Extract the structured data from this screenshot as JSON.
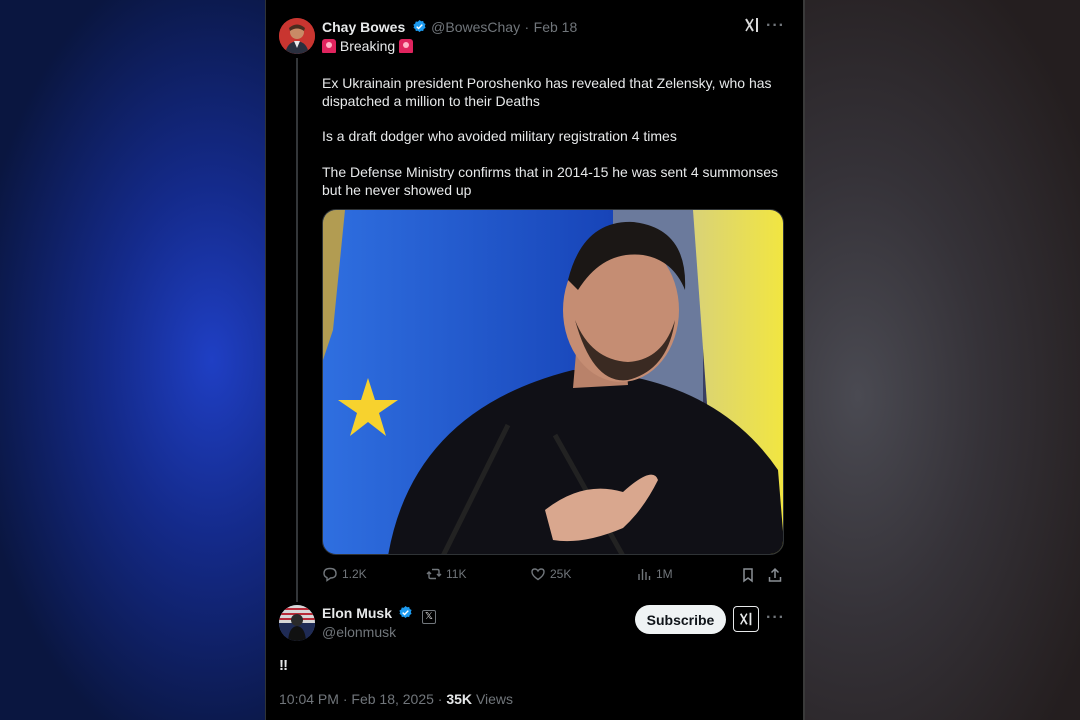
{
  "original_tweet": {
    "author_name": "Chay Bowes",
    "handle": "@BowesChay",
    "separator": "·",
    "date": "Feb 18",
    "breaking_label": "Breaking",
    "paragraphs": [
      "Ex Ukrainain president Poroshenko has revealed that Zelensky, who has dispatched a million to their Deaths",
      "Is a draft dodger who avoided military registration 4 times",
      "The Defense Ministry confirms that in 2014-15 he was sent 4 summonses but he never showed up"
    ],
    "stats": {
      "replies": "1.2K",
      "reposts": "11K",
      "likes": "25K",
      "views": "1M"
    }
  },
  "reply": {
    "author_name": "Elon Musk",
    "handle": "@elonmusk",
    "subscribe_label": "Subscribe",
    "text": "‼",
    "time": "10:04 PM",
    "separator": "·",
    "date": "Feb 18, 2025",
    "separator2": "·",
    "views_count": "35K",
    "views_label": "Views"
  },
  "icons": {
    "verified": "verified-badge-icon",
    "grok": "grok-icon",
    "more": "more-icon"
  },
  "colors": {
    "background": "#000000",
    "verified": "#1d9bf0",
    "muted": "#71767b",
    "text": "#e7e9ea",
    "subscribe_bg": "#eff3f4"
  }
}
